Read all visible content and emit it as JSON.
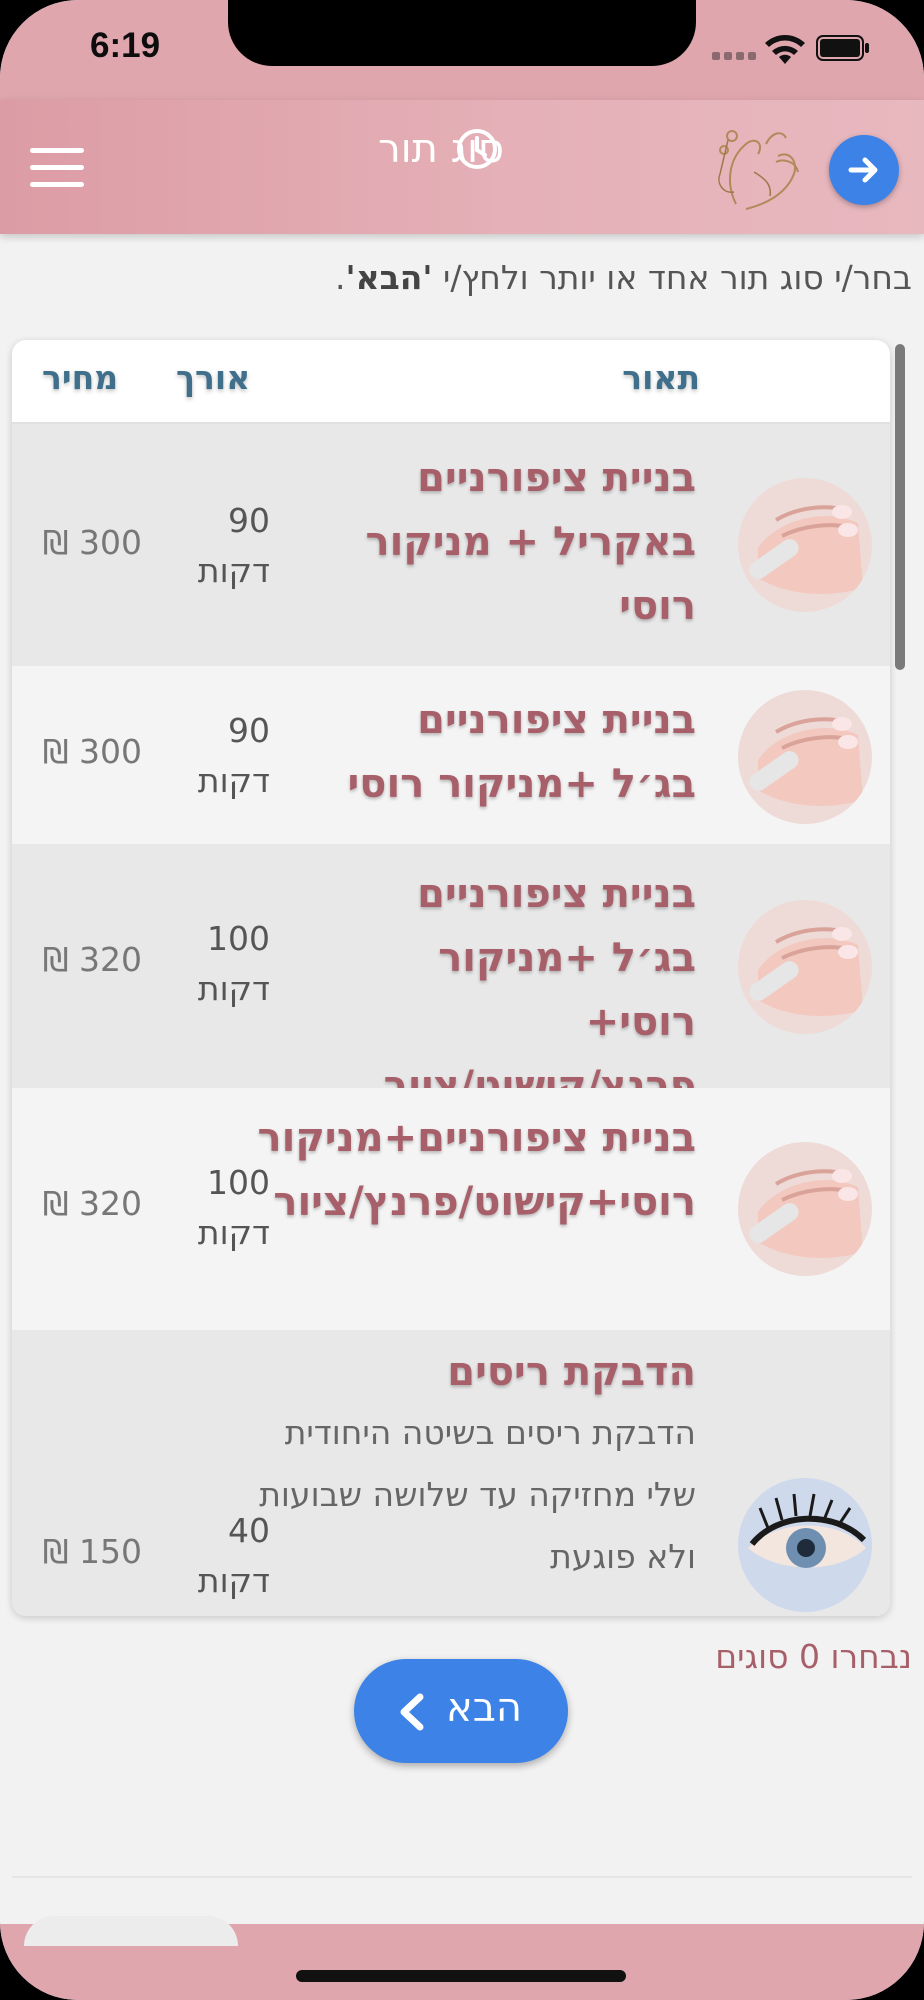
{
  "status_bar": {
    "time": "6:19"
  },
  "header": {
    "title": "סוג תור",
    "colors": {
      "header": "#dfa6ad",
      "accent_button": "#3d82e6"
    }
  },
  "instruction": {
    "text_before": "בחר/י סוג תור אחד או יותר ולחץ/י ",
    "emphasis": "'הבא'",
    "text_after": "."
  },
  "table": {
    "headers": {
      "description": "תאור",
      "length": "אורך",
      "price": "מחיר"
    },
    "rows": [
      {
        "name": "בניית ציפורניים באקריל + מניקור רוסי",
        "description": "",
        "duration": "90",
        "duration_unit": "דקות",
        "price": "300 ₪",
        "image": "nails"
      },
      {
        "name": "בניית ציפורניים בג׳ל +מניקור רוסי",
        "description": "",
        "duration": "90",
        "duration_unit": "דקות",
        "price": "300 ₪",
        "image": "nails"
      },
      {
        "name": "בניית ציפורניים בג׳ל +מניקור רוסי+ פרנץ/קישוט/ציור",
        "description": "",
        "duration": "100",
        "duration_unit": "דקות",
        "price": "320 ₪",
        "image": "nails"
      },
      {
        "name": "בניית ציפורניים+מניקור רוסי+קישוט/פרנץ/ציור",
        "description": "",
        "duration": "100",
        "duration_unit": "דקות",
        "price": "320 ₪",
        "image": "nails"
      },
      {
        "name": "הדבקת ריסים",
        "description": "הדבקת ריסים בשיטה היחודית שלי מחזיקה עד שלושה שבועות ולא פוגעת",
        "duration": "40",
        "duration_unit": "דקות",
        "price": "150 ₪",
        "image": "eyelash"
      }
    ]
  },
  "selected_count": "נבחרו 0 סוגים",
  "next_button": {
    "label": "הבא"
  },
  "icons": [
    "menu-icon",
    "clock-icon",
    "logo",
    "arrow-right-icon",
    "chevron-left-icon"
  ]
}
